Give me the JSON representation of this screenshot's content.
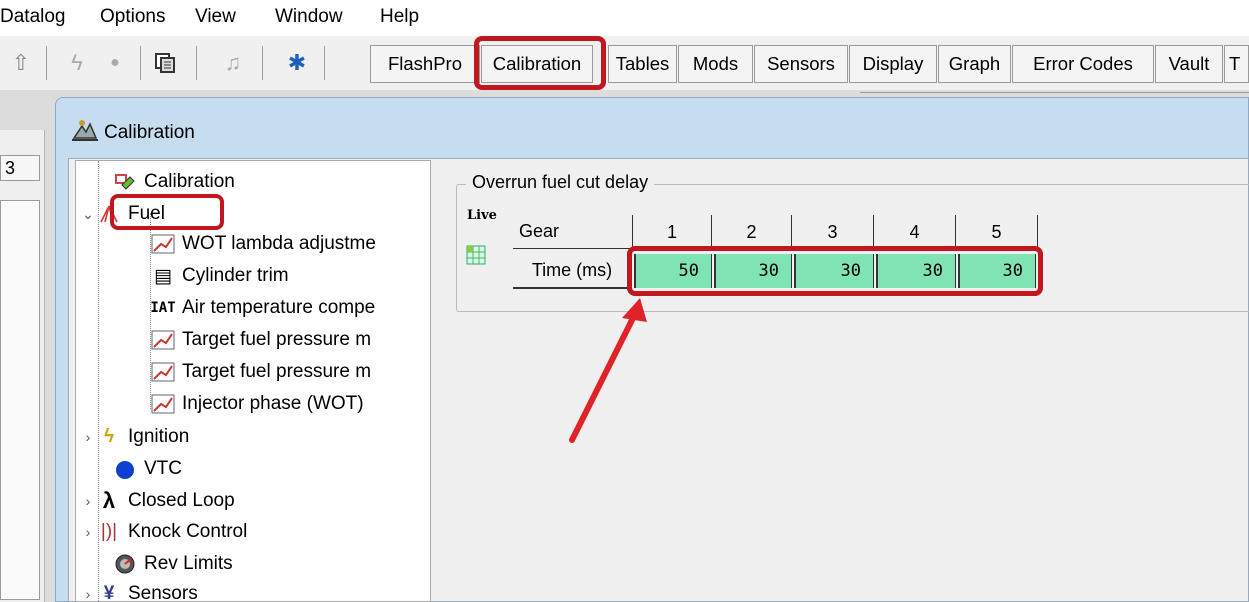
{
  "menu": [
    "Datalog",
    "Options",
    "View",
    "Window",
    "Help"
  ],
  "toolbar": {
    "icons": [
      "up-arrow-icon",
      "lightning-icon",
      "record-icon",
      "copy-icon",
      "music-icon",
      "bluetooth-icon"
    ],
    "tabs": [
      "FlashPro",
      "Calibration",
      "Tables",
      "Mods",
      "Sensors",
      "Display",
      "Graph",
      "Error Codes",
      "Vault",
      "T"
    ],
    "active_tab": "Calibration"
  },
  "left_panel_tab": "3",
  "window": {
    "title": "Calibration"
  },
  "tree": [
    {
      "label": "Calibration",
      "level": 0
    },
    {
      "label": "Fuel",
      "level": 0,
      "expanded": true,
      "selected": true
    },
    {
      "label": "WOT lambda adjustme",
      "level": 1
    },
    {
      "label": "Cylinder trim",
      "level": 1
    },
    {
      "label": "Air temperature compe",
      "level": 1,
      "icon_text": "IAT"
    },
    {
      "label": "Target fuel pressure m",
      "level": 1
    },
    {
      "label": "Target fuel pressure m",
      "level": 1
    },
    {
      "label": "Injector phase (WOT)",
      "level": 1
    },
    {
      "label": "Ignition",
      "level": 0
    },
    {
      "label": "VTC",
      "level": 0
    },
    {
      "label": "Closed Loop",
      "level": 0
    },
    {
      "label": "Knock Control",
      "level": 0
    },
    {
      "label": "Rev Limits",
      "level": 0
    },
    {
      "label": "Sensors",
      "level": 0
    }
  ],
  "group": {
    "title": "Overrun fuel cut delay",
    "live_label": "Live",
    "row_header": "Gear",
    "row_label": "Time (ms)",
    "gears": [
      "1",
      "2",
      "3",
      "4",
      "5"
    ],
    "times": [
      "50",
      "30",
      "30",
      "30",
      "30"
    ]
  },
  "colors": {
    "highlight": "#c0181e",
    "cell_fill": "#7fe3b4",
    "window_frame": "#c6dcef",
    "arrow": "#e0232a"
  }
}
